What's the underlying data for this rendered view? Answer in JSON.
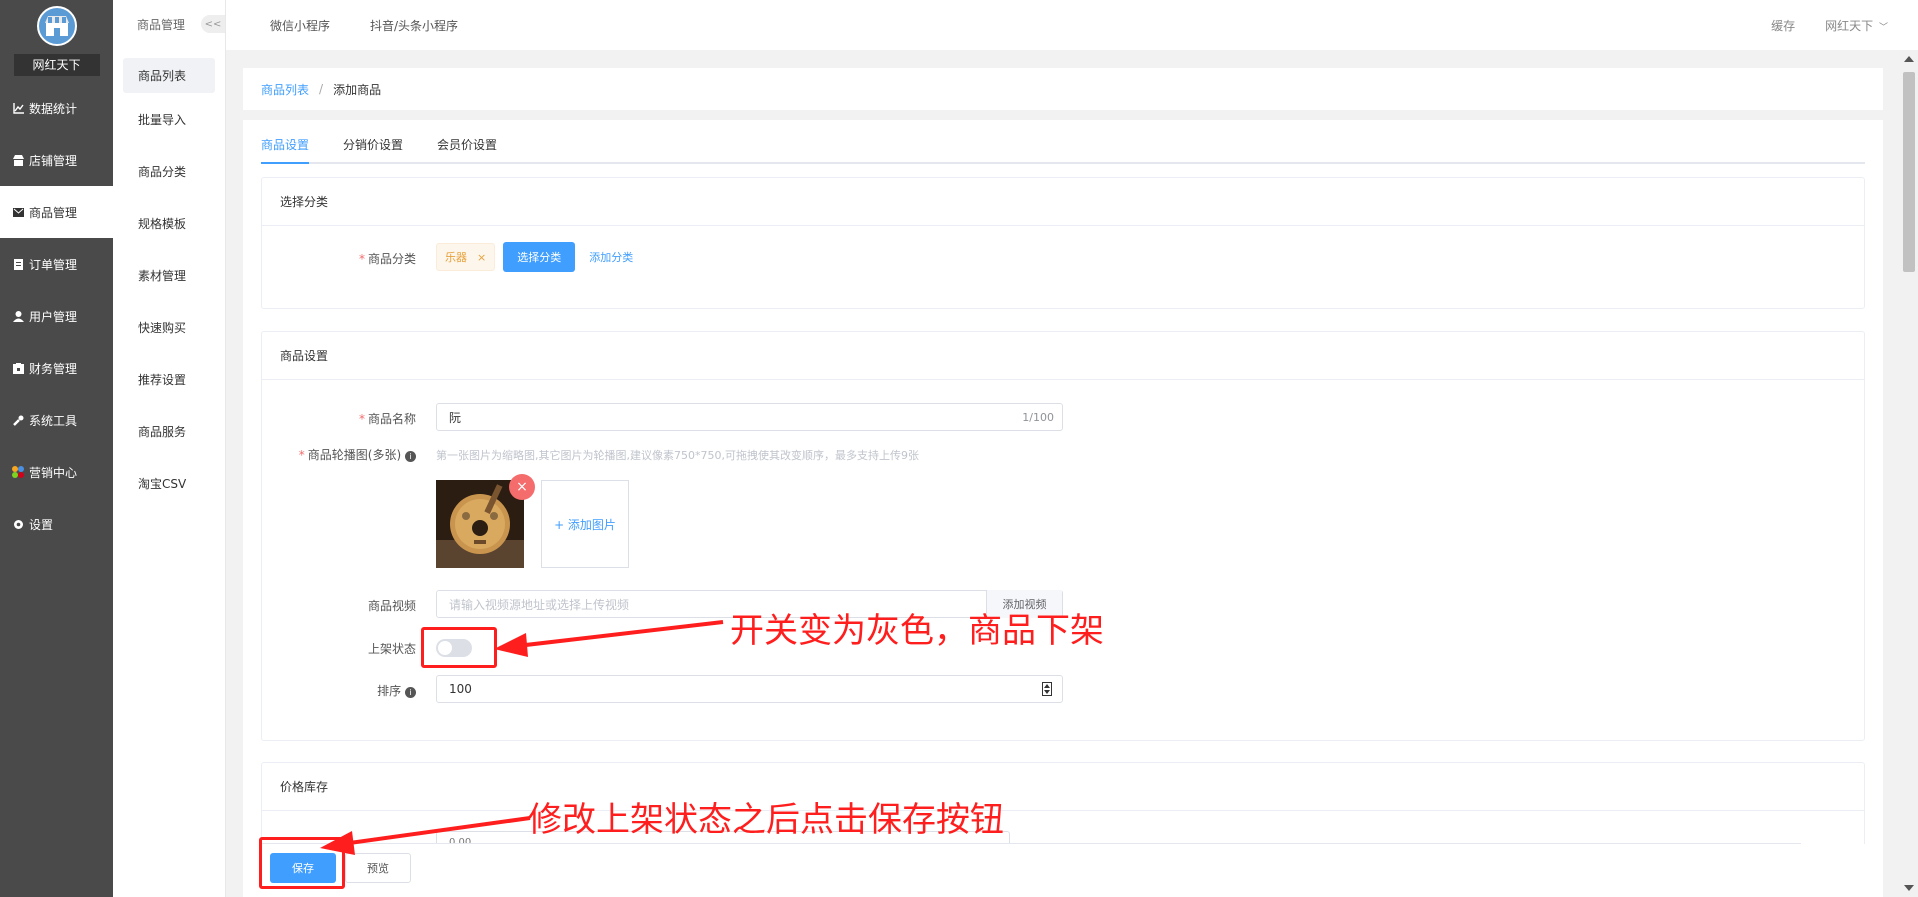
{
  "brand": {
    "name": "网红天下"
  },
  "sidebar": {
    "items": [
      {
        "label": "数据统计",
        "icon": "chart-icon"
      },
      {
        "label": "店铺管理",
        "icon": "store-icon"
      },
      {
        "label": "商品管理",
        "icon": "goods-icon"
      },
      {
        "label": "订单管理",
        "icon": "order-icon"
      },
      {
        "label": "用户管理",
        "icon": "user-icon"
      },
      {
        "label": "财务管理",
        "icon": "finance-icon"
      },
      {
        "label": "系统工具",
        "icon": "wrench-icon"
      },
      {
        "label": "营销中心",
        "icon": "marketing-icon"
      },
      {
        "label": "设置",
        "icon": "gear-icon"
      }
    ]
  },
  "submenu": {
    "title": "商品管理",
    "collapse": "<<",
    "items": [
      "商品列表",
      "批量导入",
      "商品分类",
      "规格模板",
      "素材管理",
      "快速购买",
      "推荐设置",
      "商品服务",
      "淘宝CSV"
    ]
  },
  "topbar": {
    "tabs": [
      "微信小程序",
      "抖音/头条小程序"
    ],
    "cache": "缓存",
    "user": "网红天下"
  },
  "breadcrumb": {
    "parent": "商品列表",
    "sep": "/",
    "current": "添加商品"
  },
  "tabs": [
    "商品设置",
    "分销价设置",
    "会员价设置"
  ],
  "category_section": {
    "title": "选择分类",
    "label": "商品分类",
    "tag": "乐器",
    "tag_close": "×",
    "select_btn": "选择分类",
    "add_link": "添加分类"
  },
  "goods_section": {
    "title": "商品设置",
    "name_label": "商品名称",
    "name_value": "阮",
    "name_count": "1/100",
    "images_label": "商品轮播图(多张)",
    "images_hint": "第一张图片为缩略图,其它图片为轮播图,建议像素750*750,可拖拽使其改变顺序，最多支持上传9张",
    "add_image": "+ 添加图片",
    "delete_icon": "×",
    "video_label": "商品视频",
    "video_placeholder": "请输入视频源地址或选择上传视频",
    "video_btn": "添加视频",
    "status_label": "上架状态",
    "status_on": false,
    "sort_label": "排序",
    "sort_value": "100"
  },
  "price_section": {
    "title": "价格库存",
    "price_value": "0.00"
  },
  "footer": {
    "save": "保存",
    "preview": "预览"
  },
  "annotations": {
    "switch_note": "开关变为灰色，商品下架",
    "save_note": "修改上架状态之后点击保存按钮",
    "color": "#ff1e1e"
  },
  "colors": {
    "primary": "#409eff",
    "sidebar": "#4a4a4a",
    "danger": "#f56c6c"
  }
}
